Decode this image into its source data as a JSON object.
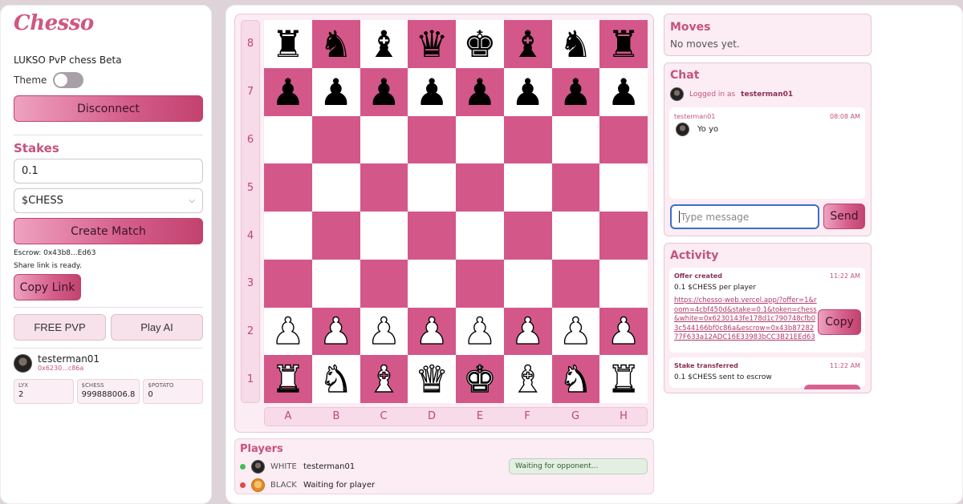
{
  "sidebar": {
    "logo": "Chesso",
    "tagline": "LUKSO PvP chess Beta",
    "theme_label": "Theme",
    "disconnect_label": "Disconnect",
    "stakes_title": "Stakes",
    "stake_amount": "0.1",
    "token_selected": "$CHESS",
    "create_match_label": "Create Match",
    "escrow_text": "Escrow: 0x43b8...Ed63",
    "share_text": "Share link is ready.",
    "copy_link_label": "Copy Link",
    "free_pvp_label": "FREE PVP",
    "play_ai_label": "Play AI",
    "user": {
      "name": "testerman01",
      "address": "0x6230...c86a"
    },
    "balances": [
      {
        "label": "LYX",
        "value": "2"
      },
      {
        "label": "$CHESS",
        "value": "999888006.8"
      },
      {
        "label": "$POTATO",
        "value": "0"
      }
    ]
  },
  "board": {
    "ranks": [
      "8",
      "7",
      "6",
      "5",
      "4",
      "3",
      "2",
      "1"
    ],
    "files": [
      "A",
      "B",
      "C",
      "D",
      "E",
      "F",
      "G",
      "H"
    ],
    "rows": [
      [
        "bR",
        "bN",
        "bB",
        "bQ",
        "bK",
        "bB",
        "bN",
        "bR"
      ],
      [
        "bP",
        "bP",
        "bP",
        "bP",
        "bP",
        "bP",
        "bP",
        "bP"
      ],
      [
        "",
        "",
        "",
        "",
        "",
        "",
        "",
        ""
      ],
      [
        "",
        "",
        "",
        "",
        "",
        "",
        "",
        ""
      ],
      [
        "",
        "",
        "",
        "",
        "",
        "",
        "",
        ""
      ],
      [
        "",
        "",
        "",
        "",
        "",
        "",
        "",
        ""
      ],
      [
        "wP",
        "wP",
        "wP",
        "wP",
        "wP",
        "wP",
        "wP",
        "wP"
      ],
      [
        "wR",
        "wN",
        "wB",
        "wQ",
        "wK",
        "wB",
        "wN",
        "wR"
      ]
    ],
    "colors": {
      "light": "#ffffff",
      "dark": "#d4578a"
    }
  },
  "players": {
    "title": "Players",
    "white": {
      "side": "WHITE",
      "name": "testerman01",
      "status": "Waiting for opponent..."
    },
    "black": {
      "side": "BLACK",
      "name": "Waiting for player"
    }
  },
  "moves": {
    "title": "Moves",
    "empty_text": "No moves yet."
  },
  "chat": {
    "title": "Chat",
    "logged_in_prefix": "Logged in as",
    "logged_in_user": "testerman01",
    "messages": [
      {
        "author": "testerman01",
        "time": "08:08 AM",
        "text": "Yo yo"
      }
    ],
    "input_placeholder": "Type message",
    "send_label": "Send"
  },
  "activity": {
    "title": "Activity",
    "items": [
      {
        "title": "Offer created",
        "time": "11:22 AM",
        "text": "0.1 $CHESS per player",
        "link": "https://chesso-web.vercel.app/?offer=1&room=4cbf450d&stake=0.1&token=chess&white=0x6230143fe178d1c790748cfb03c544166bf0c86a&escrow=0x43b8728277F633a12ADC16E33983bCC3B21EEd63",
        "copy_label": "Copy"
      },
      {
        "title": "Stake transferred",
        "time": "11:22 AM",
        "text": "0.1 $CHESS sent to escrow"
      }
    ]
  },
  "accent_color": "#c4537d"
}
